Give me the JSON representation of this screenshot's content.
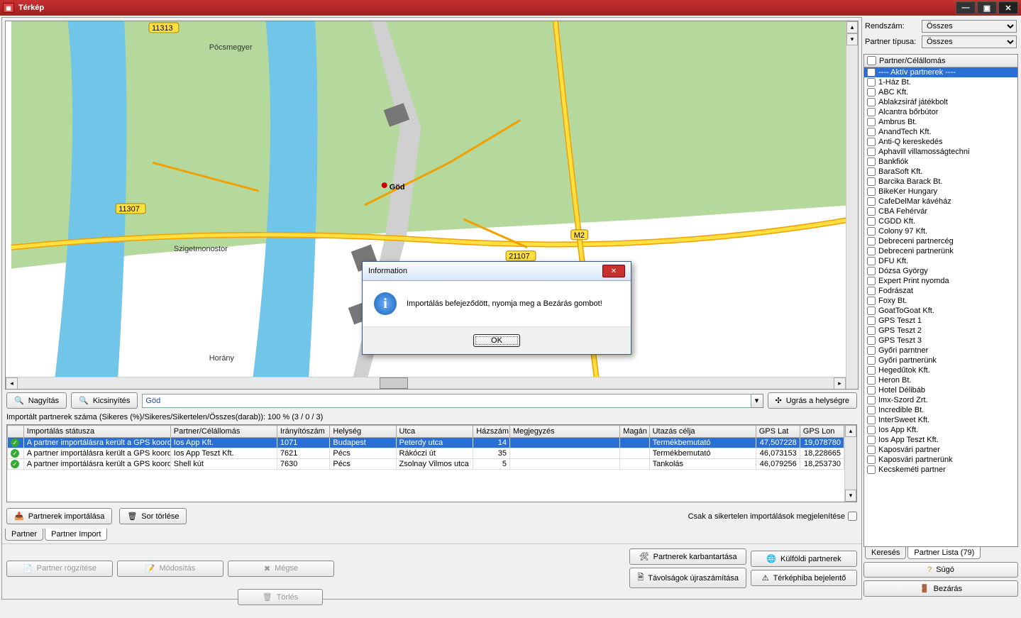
{
  "title": "Térkép",
  "filters": {
    "rendszam_label": "Rendszám:",
    "rendszam_value": "Összes",
    "partnertipus_label": "Partner típusa:",
    "partnertipus_value": "Összes"
  },
  "partner_list_header": "Partner/Célállomás",
  "partner_list": [
    "---- Aktív partnerek ----",
    "1-Ház Bt.",
    "ABC Kft.",
    "Ablakzsiráf játékbolt",
    "Alcantra bőrbútor",
    "Ambrus Bt.",
    "AnandTech Kft.",
    "Anti-Q kereskedés",
    "Aphavill villamosságtechni",
    "Bankfiók",
    "BaraSoft Kft.",
    "Barcika Barack Bt.",
    "BikeKer Hungary",
    "CafeDelMar kávéház",
    "CBA Fehérvár",
    "CGDD Kft.",
    "Colony 97 Kft.",
    "Debreceni partnercég",
    "Debreceni partnerünk",
    "DFU Kft.",
    "Dózsa György",
    "Expert Print nyomda",
    "Fodrászat",
    "Foxy Bt.",
    "GoatToGoat Kft.",
    "GPS Teszt 1",
    "GPS Teszt 2",
    "GPS Teszt 3",
    "Győri parntner",
    "Győri partnerünk",
    "Hegedűtok Kft.",
    "Heron Bt.",
    "Hotel Délibáb",
    "Imx-Szord Zrt.",
    "Incredible Bt.",
    "InterSweet Kft.",
    "Ios App Kft.",
    "Ios App Teszt Kft.",
    "Kaposvári partner",
    "Kaposvári partnerünk",
    "Kecskeméti partner"
  ],
  "map_labels": {
    "god": "Göd",
    "pocsmegyer": "Pócsmegyer",
    "horany": "Horány",
    "szigetmonostor": "Szigetmonostor",
    "r11307": "11307",
    "r11313": "11313",
    "r21107": "21107",
    "m2": "M2"
  },
  "toolbar": {
    "zoom_in": "Nagyítás",
    "zoom_out": "Kicsinyítés",
    "search_value": "Göd",
    "jump": "Ugrás a helységre"
  },
  "import_summary": "Importált partnerek száma (Sikeres (%)/Sikeres/Sikertelen/Összes(darab)):   100 % (3 / 0 / 3)",
  "grid": {
    "headers": [
      "",
      "Importálás státusza",
      "Partner/Célállomás",
      "Irányítószám",
      "Helység",
      "Utca",
      "Házszám",
      "Megjegyzés",
      "Magán",
      "Utazás célja",
      "GPS Lat",
      "GPS Lon"
    ],
    "rows": [
      {
        "status": "A partner importálásra került a GPS koordi",
        "partner": "Ios App Kft.",
        "zip": "1071",
        "city": "Budapest",
        "street": "Peterdy utca",
        "house": "14",
        "note": "",
        "private": "",
        "purpose": "Termékbemutató",
        "lat": "47,507228",
        "lon": "19,078780"
      },
      {
        "status": "A partner importálásra került a GPS koordi",
        "partner": "Ios App Teszt Kft.",
        "zip": "7621",
        "city": "Pécs",
        "street": "Rákóczi út",
        "house": "35",
        "note": "",
        "private": "",
        "purpose": "Termékbemutató",
        "lat": "46,073153",
        "lon": "18,228665"
      },
      {
        "status": "A partner importálásra került a GPS koordi",
        "partner": "Shell kút",
        "zip": "7630",
        "city": "Pécs",
        "street": "Zsolnay Vilmos utca",
        "house": "5",
        "note": "",
        "private": "",
        "purpose": "Tankolás",
        "lat": "46,079256",
        "lon": "18,253730"
      }
    ]
  },
  "actions": {
    "import_partners": "Partnerek importálása",
    "delete_row": "Sor törlése",
    "only_failed": "Csak a sikertelen importálások megjelenítése"
  },
  "tabs": {
    "partner": "Partner",
    "partner_import": "Partner Import"
  },
  "right_tabs": {
    "search": "Keresés",
    "list": "Partner Lista (79)"
  },
  "bottom": {
    "save_partner": "Partner rögzítése",
    "modify": "Módosítás",
    "cancel": "Mégse",
    "delete": "Törlés",
    "maintain": "Partnerek karbantartása",
    "foreign": "Külföldi partnerek",
    "help": "Súgó",
    "recalc": "Távolságok újraszámítása",
    "report": "Térképhiba bejelentő",
    "close": "Bezárás"
  },
  "dialog": {
    "title": "Information",
    "message": "Importálás befejeződött, nyomja meg a Bezárás gombot!",
    "ok": "OK"
  }
}
